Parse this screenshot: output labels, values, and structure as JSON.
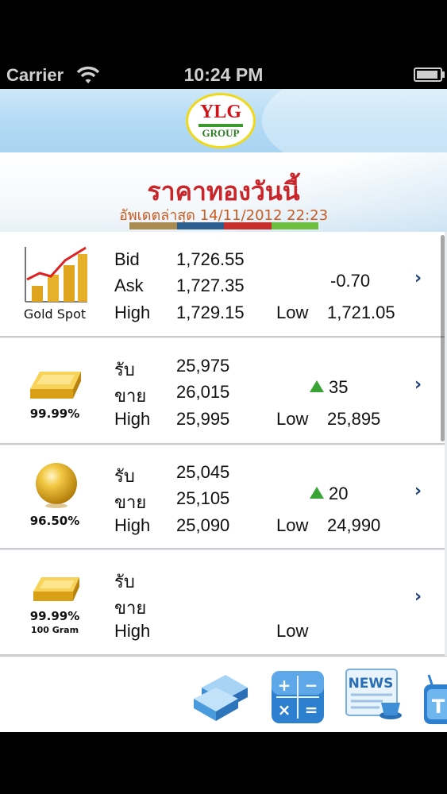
{
  "status_bar": {
    "carrier": "Carrier",
    "time": "10:24 PM"
  },
  "header": {
    "logo_main": "YLG",
    "logo_sub": "GROUP"
  },
  "title": {
    "heading": "ราคาทองวันนี้",
    "updated": "อัพเดตล่าสุด 14/11/2012 22:23"
  },
  "stripe_colors": [
    "#a98b4f",
    "#2b5d8f",
    "#c92f2a",
    "#6cbf3f"
  ],
  "rows": [
    {
      "caption": "Gold Spot",
      "labels": [
        "Bid",
        "Ask",
        "High"
      ],
      "values": [
        "1,726.55",
        "1,727.35",
        "1,729.15"
      ],
      "change": "-0.70",
      "trend": "down",
      "low_label": "Low",
      "low_value": "1,721.05"
    },
    {
      "caption": "99.99%",
      "labels": [
        "รับ",
        "ขาย",
        "High"
      ],
      "values": [
        "25,975",
        "26,015",
        "25,995"
      ],
      "change": "35",
      "trend": "up",
      "low_label": "Low",
      "low_value": "25,895"
    },
    {
      "caption": "96.50%",
      "labels": [
        "รับ",
        "ขาย",
        "High"
      ],
      "values": [
        "25,045",
        "25,105",
        "25,090"
      ],
      "change": "20",
      "trend": "up",
      "low_label": "Low",
      "low_value": "24,990"
    },
    {
      "caption": "99.99%",
      "caption_sub": "100 Gram",
      "labels": [
        "รับ",
        "ขาย",
        "High"
      ],
      "values": [
        "",
        "",
        ""
      ],
      "change": "",
      "trend": "",
      "low_label": "Low",
      "low_value": ""
    }
  ],
  "toolbar": {
    "news_label": "NEWS",
    "calc_symbols": [
      "+",
      "−",
      "×",
      "="
    ]
  },
  "colors": {
    "accent_red": "#c9262c",
    "chevron": "#1c3f7a",
    "up_green": "#3aa335"
  }
}
